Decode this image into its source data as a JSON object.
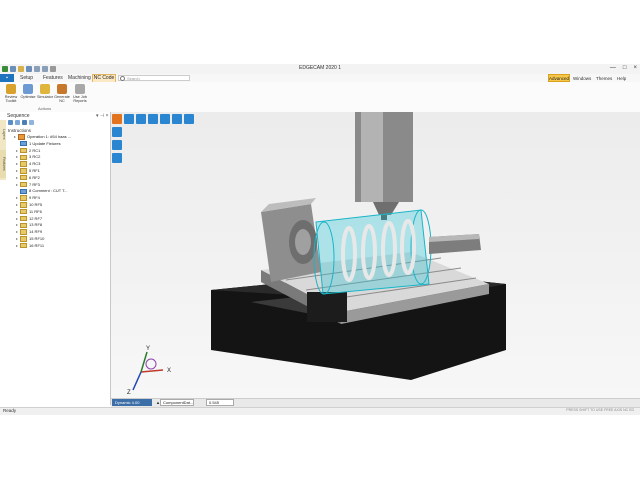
{
  "window": {
    "title": "EDGECAM 2020 1",
    "controls": [
      "—",
      "□",
      "×"
    ]
  },
  "ribbon_tabs": [
    "Setup",
    "Features",
    "Machining",
    "NC Code"
  ],
  "search": {
    "placeholder": "Search"
  },
  "menu": {
    "advanced": "Advanced",
    "windows": "Windows",
    "themes": "Themes",
    "help": "Help"
  },
  "ribbon_buttons": [
    {
      "label": "Review\nToolkit",
      "color": "#d9a22c"
    },
    {
      "label": "Optimise",
      "color": "#6b9bd2"
    },
    {
      "label": "Simulator",
      "color": "#e0b53c"
    },
    {
      "label": "Generate\nNC",
      "color": "#c8782c"
    },
    {
      "label": "Use Job\nReports",
      "color": "#a8a8a8"
    }
  ],
  "ribbon_group": "Actions",
  "sequence_panel": {
    "title": "Sequence",
    "side_tabs": [
      "Layers",
      "Features"
    ],
    "root": "Instructions",
    "items": [
      {
        "toggle": "▸",
        "kind": "op",
        "label": "Operation 1: #54 haas ..."
      },
      {
        "toggle": "",
        "kind": "fx",
        "label": "1 Update Fixtures"
      },
      {
        "toggle": "▸",
        "kind": "f",
        "label": "2 RC1"
      },
      {
        "toggle": "▸",
        "kind": "f",
        "label": "3 RC2"
      },
      {
        "toggle": "▸",
        "kind": "f",
        "label": "4 RC3"
      },
      {
        "toggle": "▸",
        "kind": "f",
        "label": "5 RF1"
      },
      {
        "toggle": "▸",
        "kind": "f",
        "label": "6 RF2"
      },
      {
        "toggle": "▸",
        "kind": "f",
        "label": "7 RF3"
      },
      {
        "toggle": "",
        "kind": "fx",
        "label": "8 Comment : CUT T..."
      },
      {
        "toggle": "▸",
        "kind": "f",
        "label": "9 RF4"
      },
      {
        "toggle": "▸",
        "kind": "f",
        "label": "10 RF5"
      },
      {
        "toggle": "▸",
        "kind": "f",
        "label": "11 RF6"
      },
      {
        "toggle": "▸",
        "kind": "f",
        "label": "12 RF7"
      },
      {
        "toggle": "▸",
        "kind": "f",
        "label": "13 RF8"
      },
      {
        "toggle": "▸",
        "kind": "f",
        "label": "14 RF9"
      },
      {
        "toggle": "▸",
        "kind": "f",
        "label": "15 RF10"
      },
      {
        "toggle": "▸",
        "kind": "f",
        "label": "16 RF11"
      }
    ]
  },
  "viewport": {
    "axis_x": "X",
    "axis_y": "Y",
    "axis_z": "Z"
  },
  "viewport_status": {
    "mode": "Dynamic 4.00",
    "component": "ComponentDat...",
    "value": "0.545"
  },
  "status": {
    "text": "Ready",
    "right": "PRESS SHIFT TO USE FREE AXIS    NC  ED"
  }
}
